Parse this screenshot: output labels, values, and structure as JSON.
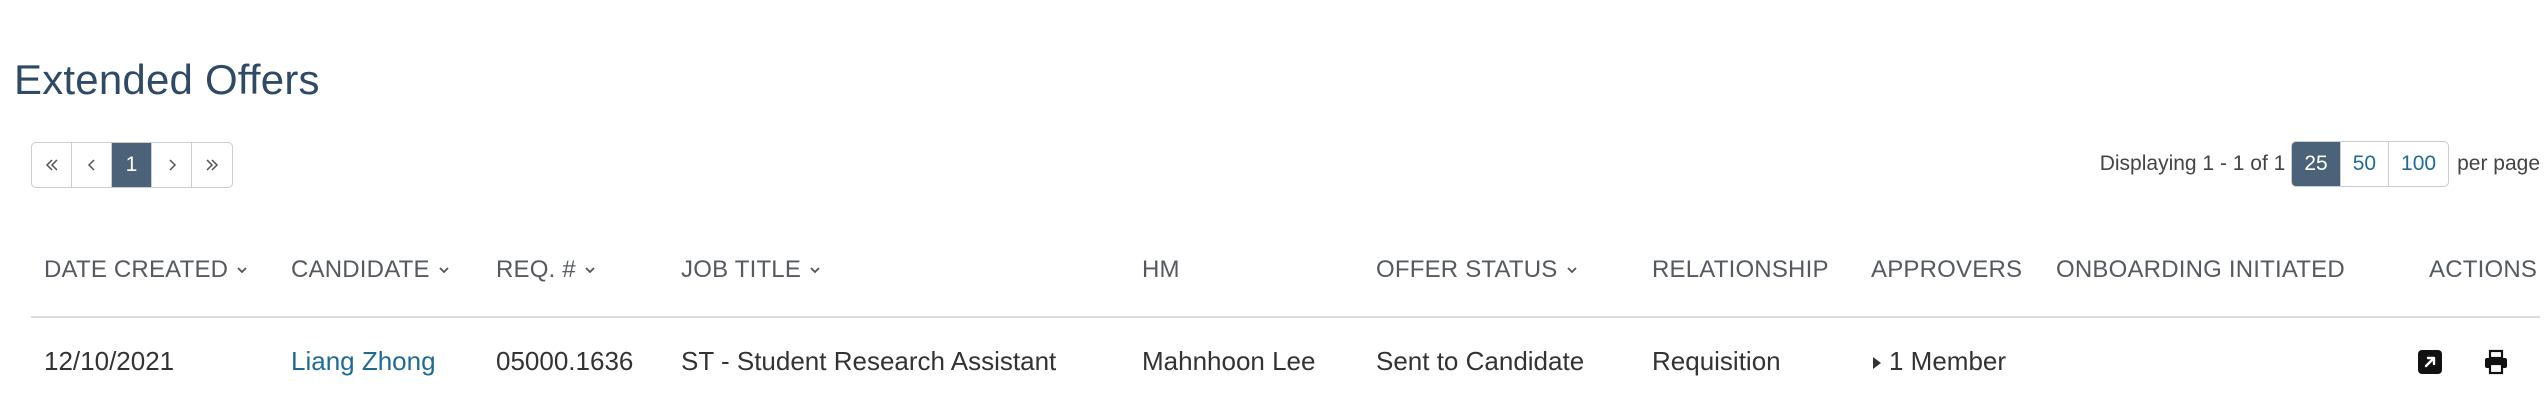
{
  "page": {
    "title": "Extended Offers"
  },
  "pagination": {
    "first": "«",
    "prev": "‹",
    "current": "1",
    "next": "›",
    "last": "»",
    "displaying": "Displaying 1 - 1 of 1",
    "sizes": [
      "25",
      "50",
      "100"
    ],
    "selected_size": "25",
    "per_page_label": "per page"
  },
  "table": {
    "headers": {
      "date_created": "DATE CREATED",
      "candidate": "CANDIDATE",
      "req": "REQ. #",
      "job_title": "JOB TITLE",
      "hm": "HM",
      "offer_status": "OFFER STATUS",
      "relationship": "RELATIONSHIP",
      "approvers": "APPROVERS",
      "onboarding": "ONBOARDING INITIATED",
      "actions": "ACTIONS"
    },
    "rows": [
      {
        "date_created": "12/10/2021",
        "candidate": "Liang Zhong",
        "req": "05000.1636",
        "job_title": "ST - Student Research Assistant",
        "hm": "Mahnhoon Lee",
        "offer_status": "Sent to Candidate",
        "relationship": "Requisition",
        "approvers": "1 Member",
        "onboarding": ""
      }
    ]
  },
  "icons": {
    "caret": "caret-down-icon",
    "expand": "triangle-right-icon",
    "open": "external-link-icon",
    "print": "printer-icon"
  },
  "colors": {
    "title": "#2e4a66",
    "active_bg": "#4b6278",
    "link": "#1f6b95"
  }
}
